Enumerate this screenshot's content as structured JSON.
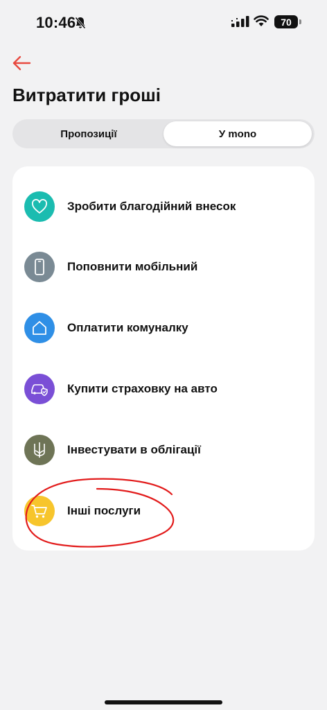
{
  "status_bar": {
    "time": "10:46",
    "battery": "70",
    "icons": [
      "bell-slash-icon",
      "signal-icon",
      "wifi-icon",
      "battery-icon"
    ]
  },
  "header": {
    "back_icon": "arrow-left-icon",
    "title": "Витратити гроші"
  },
  "tabs": [
    {
      "label": "Пропозиції",
      "selected": false
    },
    {
      "label": "У mono",
      "selected": true
    }
  ],
  "services": [
    {
      "label": "Зробити благодійний внесок",
      "icon": "heart-icon",
      "color": "#1bbcb0"
    },
    {
      "label": "Поповнити мобільний",
      "icon": "phone-icon",
      "color": "#7a8a94"
    },
    {
      "label": "Оплатити комуналку",
      "icon": "house-icon",
      "color": "#2f8fe6"
    },
    {
      "label": "Купити страховку на авто",
      "icon": "car-shield-icon",
      "color": "#7a4fd6"
    },
    {
      "label": "Інвестувати в облігації",
      "icon": "trident-icon",
      "color": "#6e7456"
    },
    {
      "label": "Інші послуги",
      "icon": "cart-icon",
      "color": "#f7c52c"
    }
  ],
  "colors": {
    "accent": "#e8493f",
    "background": "#f2f2f3",
    "annotation": "#e21b1b"
  }
}
